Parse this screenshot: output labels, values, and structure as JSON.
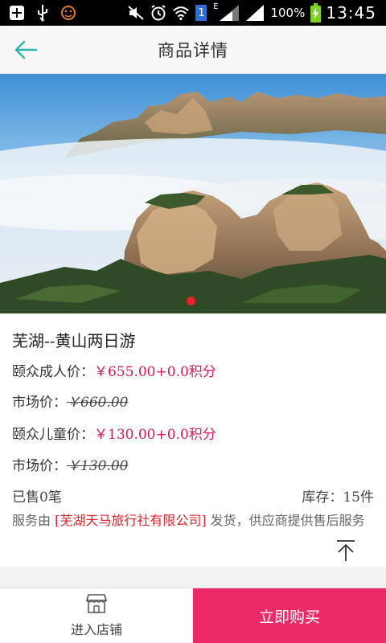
{
  "status_bar": {
    "battery_percent": "100%",
    "time": "13:45",
    "sim_badge": "1",
    "network_label": "E"
  },
  "header": {
    "title": "商品详情"
  },
  "gallery": {
    "dot_color": "#e8222c"
  },
  "product": {
    "title": "芜湖--黄山两日游",
    "adult_label": "颐众成人价：",
    "adult_price": "￥655.00+0.0积分",
    "market_label_1": "市场价：",
    "market_price_1": "￥660.00",
    "child_label": "颐众儿童价：",
    "child_price": "￥130.00+0.0积分",
    "market_label_2": "市场价：",
    "market_price_2": "￥130.00",
    "sold": "已售0笔",
    "stock": "库存：15件",
    "service_prefix": "服务由 ",
    "service_shop": "[芜湖天马旅行社有限公司]",
    "service_suffix": " 发货，供应商提供售后服务"
  },
  "bottom_bar": {
    "store_label": "进入店铺",
    "buy_label": "立即购买"
  },
  "colors": {
    "accent": "#ec2a65",
    "price": "#d6185c",
    "back_arrow": "#2bb7a8"
  }
}
